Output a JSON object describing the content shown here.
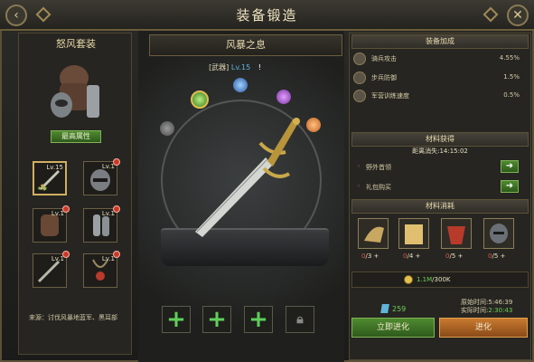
{
  "window": {
    "title": "装备锻造"
  },
  "left": {
    "set_name": "怒风套装",
    "max_attr_label": "最高属性",
    "slots": [
      {
        "lv": "Lv.15",
        "selected": true
      },
      {
        "lv": "Lv.1"
      },
      {
        "lv": "Lv.1"
      },
      {
        "lv": "Lv.1"
      },
      {
        "lv": "Lv.1"
      },
      {
        "lv": "Lv.1"
      }
    ],
    "source": "来源：讨伐风暴地蓝军、黑耳部"
  },
  "center": {
    "item_name": "风暴之息",
    "type_tag": "[武器]",
    "level": "Lv.15",
    "info_mark": "!",
    "plus": "+"
  },
  "right": {
    "bonus_header": "装备加成",
    "bonuses": [
      {
        "name": "骑兵攻击",
        "value": "4.55%",
        "icon": "sword-icon"
      },
      {
        "name": "步兵防御",
        "value": "1.5%",
        "icon": "shield-icon"
      },
      {
        "name": "军营训练速度",
        "value": "0.5%",
        "icon": "clock-icon"
      }
    ],
    "obtain_header": "材料获得",
    "countdown_label": "距离消失:14:15:02",
    "obtain": [
      {
        "name": "野外首领"
      },
      {
        "name": "礼包购买"
      }
    ],
    "consume_header": "材料消耗",
    "materials": [
      {
        "have": "0",
        "need": "/3",
        "plus": "+"
      },
      {
        "have": "0",
        "need": "/4",
        "plus": "+"
      },
      {
        "have": "0",
        "need": "/5",
        "plus": "+"
      },
      {
        "have": "0",
        "need": "/5",
        "plus": "+"
      }
    ],
    "gold_have": "1.1M",
    "gold_need": "/300K",
    "gem_count": "259",
    "base_time": "原始时间:",
    "base_time_val": "5:46:39",
    "real_time": "实际时间:",
    "real_time_val": "2:30:43",
    "instant_btn": "立即进化",
    "evolve_btn": "进化"
  },
  "colors": {
    "accent_gold": "#e8d9a8",
    "green": "#5ed05a",
    "red": "#d85a4a",
    "cyan": "#5fb4d8"
  }
}
